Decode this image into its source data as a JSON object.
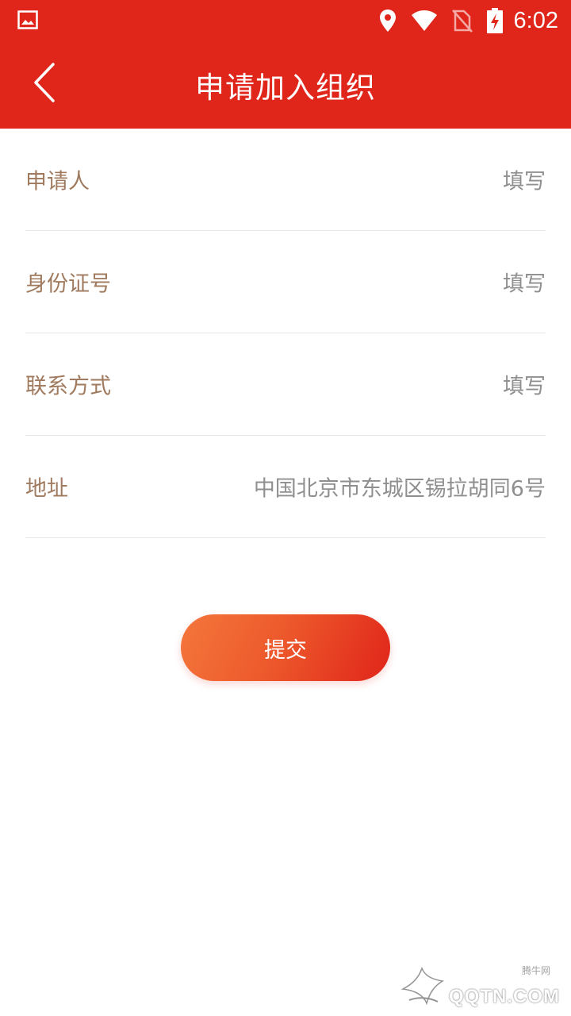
{
  "status_bar": {
    "time": "6:02",
    "icons": [
      "image-icon",
      "location-icon",
      "wifi-icon",
      "no-sim-icon",
      "battery-charging-icon"
    ]
  },
  "header": {
    "title": "申请加入组织",
    "back_icon": "chevron-left-icon"
  },
  "form": {
    "rows": [
      {
        "label": "申请人",
        "value": "填写"
      },
      {
        "label": "身份证号",
        "value": "填写"
      },
      {
        "label": "联系方式",
        "value": "填写"
      },
      {
        "label": "地址",
        "value": "中国北京市东城区锡拉胡同6号"
      }
    ]
  },
  "actions": {
    "submit_label": "提交"
  },
  "watermark": {
    "small_text": "腾牛网",
    "big_text": "QQTN.COM"
  },
  "colors": {
    "primary": "#e0251a",
    "button_start": "#f4773c",
    "label": "#a07a5e",
    "value": "#8f8f8f"
  }
}
